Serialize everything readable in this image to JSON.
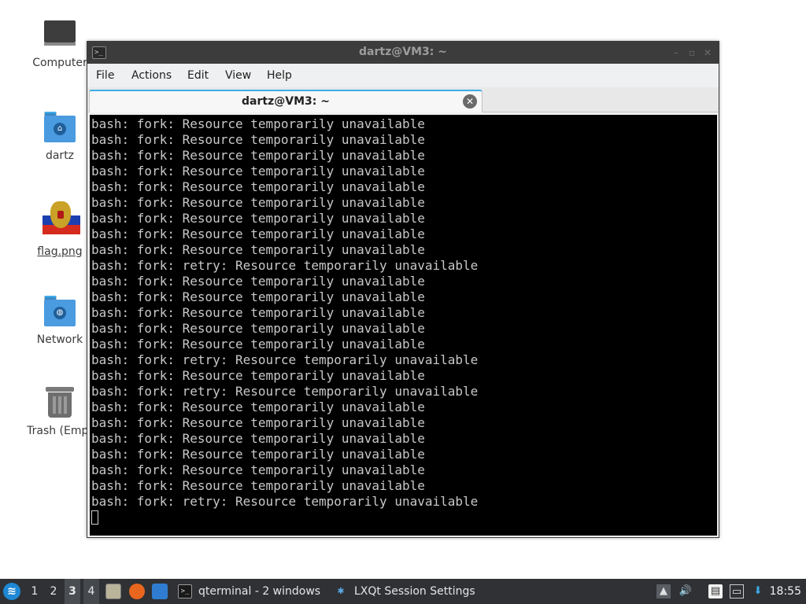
{
  "desktop": {
    "icons": [
      {
        "label": "Computer",
        "icon": "computer-icon"
      },
      {
        "label": "dartz",
        "icon": "home-folder-icon"
      },
      {
        "label": "flag.png",
        "icon": "image-file-icon"
      },
      {
        "label": "Network",
        "icon": "network-folder-icon"
      },
      {
        "label": "Trash (Empt",
        "icon": "trash-icon"
      }
    ]
  },
  "window": {
    "title": "dartz@VM3: ~",
    "menu": [
      "File",
      "Actions",
      "Edit",
      "View",
      "Help"
    ],
    "tab_label": "dartz@VM3: ~",
    "close_glyph": "✕"
  },
  "terminal": {
    "lines": [
      "bash: fork: Resource temporarily unavailable",
      "bash: fork: Resource temporarily unavailable",
      "bash: fork: Resource temporarily unavailable",
      "bash: fork: Resource temporarily unavailable",
      "bash: fork: Resource temporarily unavailable",
      "bash: fork: Resource temporarily unavailable",
      "bash: fork: Resource temporarily unavailable",
      "bash: fork: Resource temporarily unavailable",
      "bash: fork: Resource temporarily unavailable",
      "bash: fork: retry: Resource temporarily unavailable",
      "bash: fork: Resource temporarily unavailable",
      "bash: fork: Resource temporarily unavailable",
      "bash: fork: Resource temporarily unavailable",
      "bash: fork: Resource temporarily unavailable",
      "bash: fork: Resource temporarily unavailable",
      "bash: fork: retry: Resource temporarily unavailable",
      "bash: fork: Resource temporarily unavailable",
      "bash: fork: retry: Resource temporarily unavailable",
      "bash: fork: Resource temporarily unavailable",
      "bash: fork: Resource temporarily unavailable",
      "bash: fork: Resource temporarily unavailable",
      "bash: fork: Resource temporarily unavailable",
      "bash: fork: Resource temporarily unavailable",
      "bash: fork: Resource temporarily unavailable",
      "bash: fork: retry: Resource temporarily unavailable"
    ]
  },
  "taskbar": {
    "workspaces": [
      "1",
      "2",
      "3",
      "4"
    ],
    "active_workspace": "3",
    "tasks": [
      {
        "label": "qterminal - 2 windows",
        "icon": "terminal-icon"
      },
      {
        "label": "LXQt Session Settings",
        "icon": "settings-icon"
      }
    ],
    "clock": "18:55"
  },
  "colors": {
    "terminal_bg": "#000000",
    "terminal_fg": "#c8c8c8",
    "titlebar_bg": "#3c3c3c",
    "taskbar_bg": "#2f3135",
    "accent": "#3daee9"
  }
}
